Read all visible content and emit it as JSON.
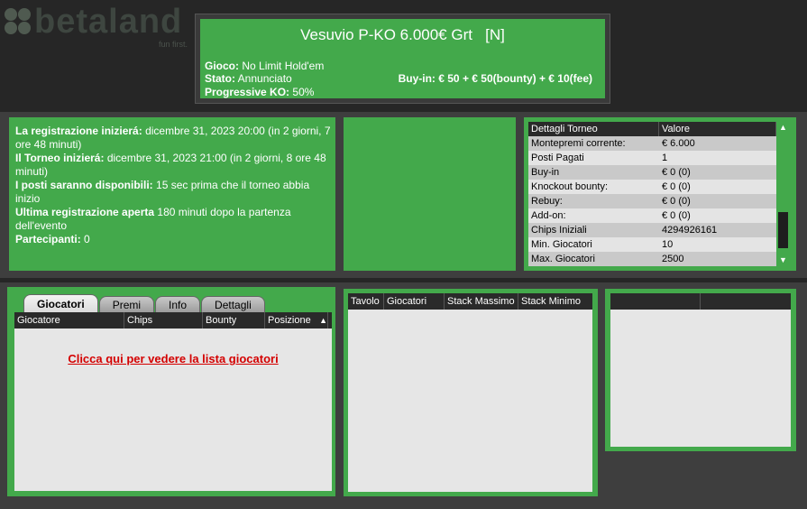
{
  "logo": {
    "text": "betaland",
    "tagline": "fun first."
  },
  "header": {
    "title": "Vesuvio P-KO 6.000€ Grt",
    "title_flag": "[N]",
    "game_label": "Gioco:",
    "game_value": "No Limit Hold'em",
    "state_label": "Stato:",
    "state_value": "Annunciato",
    "progressive_label": "Progressive KO:",
    "progressive_value": "50%",
    "buyin_label": "Buy-in:",
    "buyin_value": "€ 50 + € 50(bounty) + € 10(fee)"
  },
  "registration": {
    "reg_start_label": "La registrazione inizierá:",
    "reg_start_value": "dicembre 31, 2023 20:00 (in 2 giorni, 7 ore 48 minuti)",
    "start_label": "Il Torneo inizierá:",
    "start_value": "dicembre 31, 2023 21:00 (in 2 giorni, 8 ore 48 minuti)",
    "seats_label": "I posti saranno disponibili:",
    "seats_value": "15 sec prima che il torneo abbia inizio",
    "late_label": "Ultima registrazione aperta",
    "late_value": "180 minuti dopo la partenza dell'evento",
    "participants_label": "Partecipanti:",
    "participants_value": "0"
  },
  "details": {
    "headers": [
      "Dettagli Torneo",
      "Valore"
    ],
    "rows": [
      [
        "Montepremi corrente:",
        "€ 6.000"
      ],
      [
        "Posti Pagati",
        "1"
      ],
      [
        "Buy-in",
        "€ 0 (0)"
      ],
      [
        "Knockout bounty:",
        "€ 0 (0)"
      ],
      [
        "Rebuy:",
        "€ 0 (0)"
      ],
      [
        "Add-on:",
        "€ 0 (0)"
      ],
      [
        "Chips Iniziali",
        "4294926161"
      ],
      [
        "Min. Giocatori",
        "10"
      ],
      [
        "Max. Giocatori",
        "2500"
      ]
    ]
  },
  "players": {
    "tabs": [
      "Giocatori",
      "Premi",
      "Info",
      "Dettagli"
    ],
    "headers": [
      "Giocatore",
      "Chips",
      "Bounty",
      "Posizione"
    ],
    "link": "Clicca qui per vedere la lista giocatori"
  },
  "tables": {
    "headers": [
      "Tavolo",
      "Giocatori",
      "Stack Massimo",
      "Stack Minimo"
    ]
  },
  "colors": {
    "panel_green": "#43a94b",
    "background": "#262626",
    "link_red": "#d40000"
  }
}
